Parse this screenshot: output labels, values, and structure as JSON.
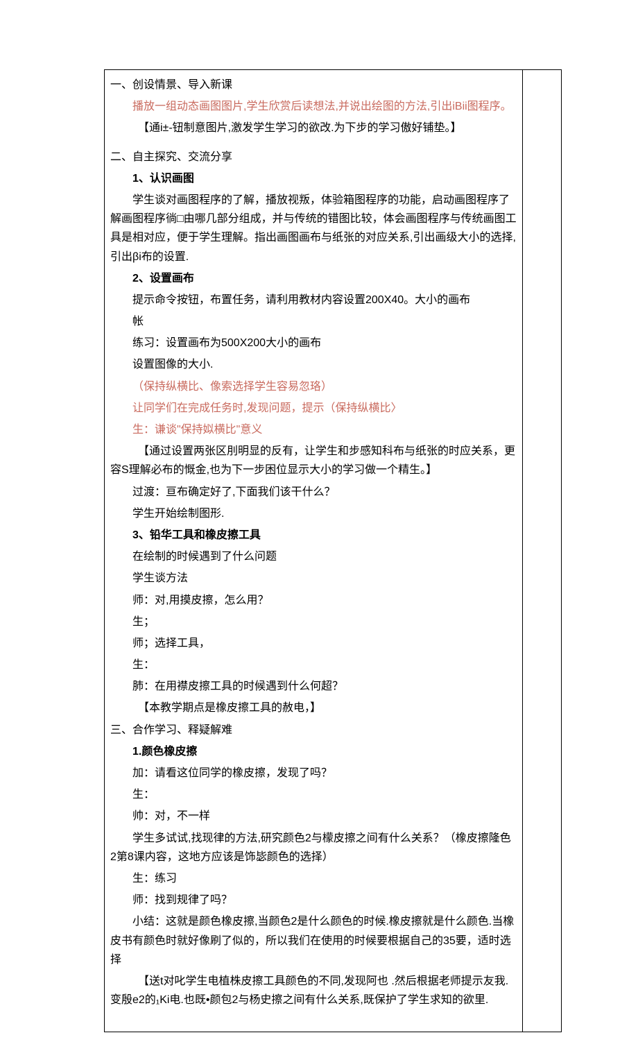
{
  "sec1": {
    "heading": "一、创设情景、导入新课",
    "p1": "播放一组动态画图图片,学生欣赏后读想法,并说出绘图的方法,引出iBii图程序。",
    "p2": "【通i±-钮制意图片,激发学生学习的欲改.为下步的学习傲好铺垫。】"
  },
  "sec2": {
    "heading": "二、自主探究、交流分享",
    "s1t": "1、认识画图",
    "s1p1": "学生谈对画图程序的了解，播放视叛，体验箱图程序的功能，启动画图程序了解画图程序徜□由哪几部分组成，并与传统的错图比较，体会画图程序与传统画图工具是相对应，便于学生理解。指出画图画布与纸张的对应关系,引出画级大小的选择,引出βi布的设置.",
    "s2t": "2、设置画布",
    "s2p1": "提示命令按钮，布置任务，请利用教材内容设置200X40。大小的画布",
    "s2p2": "帐",
    "s2p3": "练习：设置画布为500X200大小的画布",
    "s2p4": "设置图像的大小.",
    "s2r1": "（保持纵横比、像索选择学生容易忽珞）",
    "s2r2": "让同学们在完成任务时,发现问题，提示（保持纵横比〉",
    "s2r3": "生：谦谈\"保持姒横比\"意义",
    "s2p5": "【通过设置两张区刖明显的反有，让学生和步感知科布与纸张的时应关系，更容S理解必布的慨金,也为下一步困位显示大小的学习做一个精生。】",
    "s2p6": "过渡：亘布确定好了,下面我们该干什么？",
    "s2p7": "学生开始绘制图形.",
    "s3t": "3、铅华工具和橡皮擦工具",
    "s3p1": "在绘制的时候遇到了什么问题",
    "s3p2": "学生谈方法",
    "s3p3": "师：对,用摸皮擦，怎么用？",
    "s3p4": "生；",
    "s3p5": "师；选择工具，",
    "s3p6": "生：",
    "s3p7": "肺：在用襟皮擦工具的时候遇到什么何超？",
    "s3p8": "【本教学期点是橡皮擦工具的赦电，】"
  },
  "sec3": {
    "heading": "三、合作学习、释疑解难",
    "s1t": "1.颜色橡皮擦",
    "p1": "加：请看这位同学的橡皮擦，发现了吗？",
    "p2": "生：",
    "p3": "帅：对，不一样",
    "p4": "学生多试试,找现律的方法,研究颜色2与檬皮擦之间有什么关系？（橡皮擦隆色2第8课内容，这地方应该是饰毖颜色的选择）",
    "p5": "生：练习",
    "p6": "师：找到规律了吗？",
    "p7": "小结：这就是颜色橡皮擦,当颜色2是什么颜色的时候.橡皮擦就是什么颜色.当橡皮书有颜色时就好像刷了似的，所以我们在使用的时候要根据自己的35要，适时选择",
    "p8": "【送t对叱学生电植株皮擦工具颜色的不同,发现阿也 .然后根据老师提示友我.变殷e2的₁Ki电.也既•颜包2与杨史擦之间有什么关系,既保护了学生求知的欲里."
  }
}
